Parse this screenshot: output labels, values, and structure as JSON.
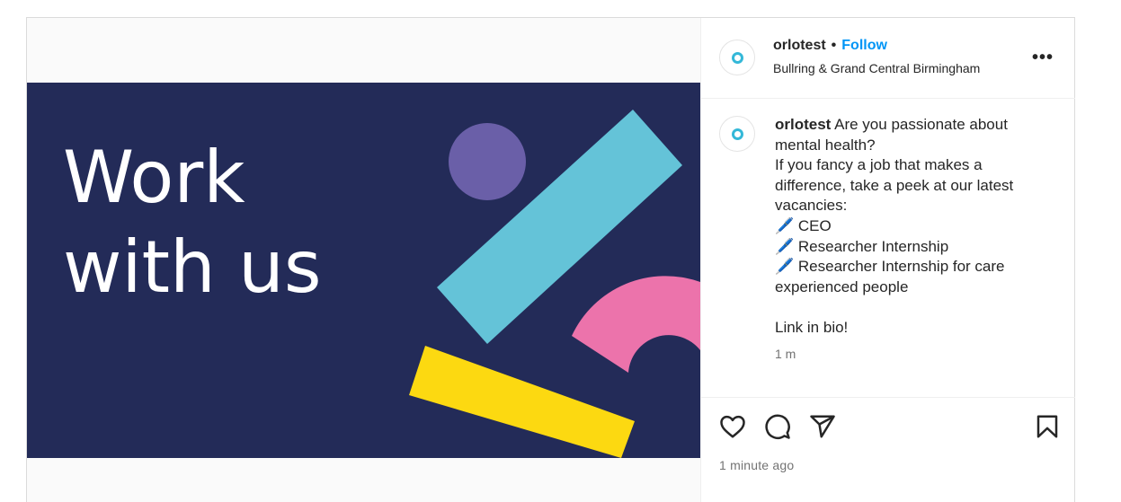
{
  "post": {
    "username": "orlotest",
    "separator": "•",
    "follow_label": "Follow",
    "location": "Bullring & Grand Central Birmingham",
    "more_label": "•••",
    "image_text_line1": "Work",
    "image_text_line2": "with us",
    "caption_user": "orlotest",
    "caption_text": " Are you passionate about mental health?\nIf you fancy a job that makes a difference, take a peek at our latest vacancies:\n🖊️ CEO\n🖊️ Researcher Internship\n🖊️ Researcher Internship for care experienced people\n\nLink in bio!",
    "caption_time": "1 m",
    "time_ago": "1 minute ago"
  },
  "icons": {
    "like": "heart-icon",
    "comment": "comment-icon",
    "share": "paper-plane-icon",
    "save": "bookmark-icon",
    "more": "more-options-icon",
    "avatar": "profile-avatar"
  },
  "colors": {
    "image_bg": "#232b58",
    "circle": "#6a5fa8",
    "bar_blue": "#64c3d8",
    "arc_pink": "#ec73ab",
    "bar_yellow": "#fcd911",
    "follow": "#0095f6"
  }
}
